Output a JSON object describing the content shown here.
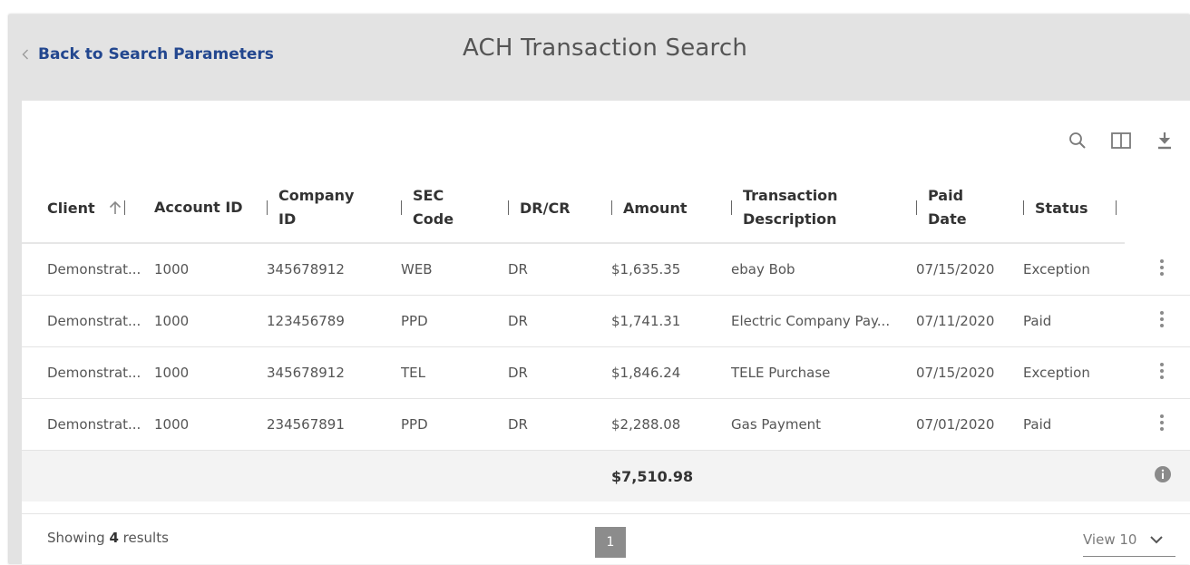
{
  "header": {
    "back_label": "Back to Search Parameters",
    "title": "ACH Transaction Search"
  },
  "toolbar": {
    "icons": [
      "search-icon",
      "columns-icon",
      "download-icon"
    ]
  },
  "table": {
    "columns": [
      {
        "key": "client",
        "label": "Client",
        "sorted": "asc"
      },
      {
        "key": "account_id",
        "label": "Account ID"
      },
      {
        "key": "company_id",
        "label": "Company ID"
      },
      {
        "key": "sec_code",
        "label": "SEC Code"
      },
      {
        "key": "drcr",
        "label": "DR/CR"
      },
      {
        "key": "amount",
        "label": "Amount"
      },
      {
        "key": "description",
        "label": "Transaction Description"
      },
      {
        "key": "paid_date",
        "label": "Paid Date"
      },
      {
        "key": "status",
        "label": "Status"
      }
    ],
    "rows": [
      {
        "client": "Demonstrat...",
        "account_id": "1000",
        "company_id": "345678912",
        "sec_code": "WEB",
        "drcr": "DR",
        "amount": "$1,635.35",
        "description": "ebay Bob",
        "paid_date": "07/15/2020",
        "status": "Exception"
      },
      {
        "client": "Demonstrat...",
        "account_id": "1000",
        "company_id": "123456789",
        "sec_code": "PPD",
        "drcr": "DR",
        "amount": "$1,741.31",
        "description": "Electric Company Pay...",
        "paid_date": "07/11/2020",
        "status": "Paid"
      },
      {
        "client": "Demonstrat...",
        "account_id": "1000",
        "company_id": "345678912",
        "sec_code": "TEL",
        "drcr": "DR",
        "amount": "$1,846.24",
        "description": "TELE Purchase",
        "paid_date": "07/15/2020",
        "status": "Exception"
      },
      {
        "client": "Demonstrat...",
        "account_id": "1000",
        "company_id": "234567891",
        "sec_code": "PPD",
        "drcr": "DR",
        "amount": "$2,288.08",
        "description": "Gas Payment",
        "paid_date": "07/01/2020",
        "status": "Paid"
      }
    ],
    "total_amount": "$7,510.98"
  },
  "footer": {
    "showing_prefix": "Showing",
    "showing_count": "4",
    "showing_suffix": "results",
    "current_page": "1",
    "view_label": "View 10"
  },
  "colors": {
    "link": "#23478f",
    "panel_bg": "#e3e3e3",
    "total_bg": "#f3f3f3",
    "page_btn": "#8c8c8c"
  }
}
